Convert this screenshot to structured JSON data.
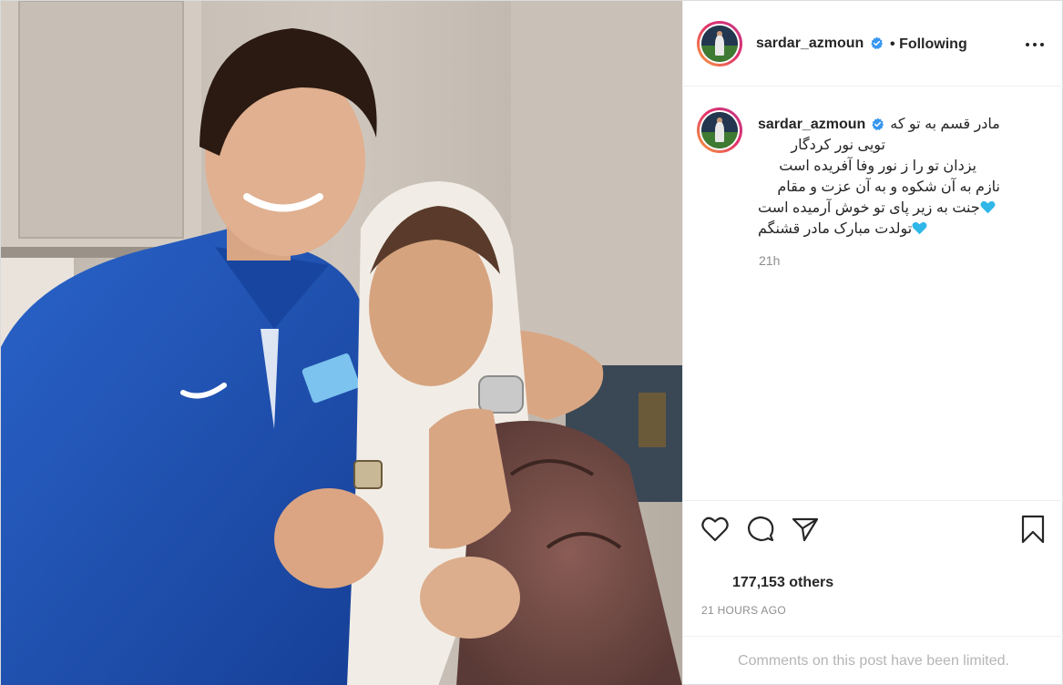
{
  "post": {
    "username": "sardar_azmoun",
    "follow_separator": "•",
    "follow_status": "Following",
    "caption_username": "sardar_azmoun",
    "caption_lines": [
      "مادر قسم به تو که",
      "تویی نور کردگار",
      "یزدان تو را ز نور وفا آفریده است",
      "نازم به آن شکوه و به آن عزت و مقام",
      "جنت به زیر پای تو خوش آرمیده است",
      "تولدت مبارک مادر قشنگم"
    ],
    "time_ago": "21h",
    "likes_text": "177,153 others",
    "date_text": "21 HOURS AGO",
    "comments_limited_text": "Comments on this post have been limited."
  },
  "icons": {
    "verified": "verified-badge-icon",
    "more": "more-options-icon",
    "like": "heart-outline-icon",
    "comment": "comment-bubble-icon",
    "share": "paper-plane-icon",
    "save": "bookmark-icon",
    "caption_heart": "blue-heart-emoji"
  },
  "colors": {
    "verified_blue": "#3897f0",
    "heart_emoji": "#2fb7e8",
    "muted_text": "#8e8e8e",
    "jersey_blue": "#1f54b8"
  }
}
